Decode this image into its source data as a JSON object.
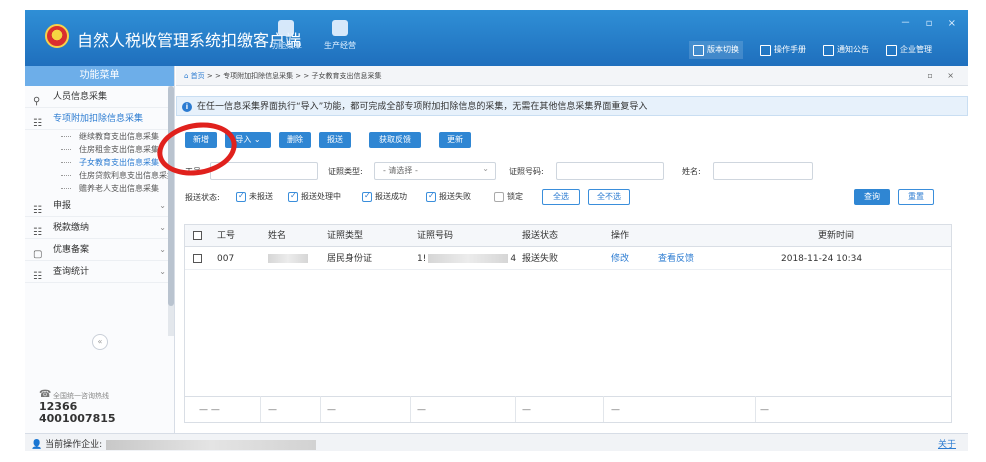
{
  "window": {
    "title": "自然人税收管理系统扣缴客户端",
    "tools": [
      "功能菜单",
      "生产经营"
    ],
    "header_buttons": [
      "版本切换",
      "操作手册",
      "通知公告",
      "企业管理"
    ],
    "controls": "－ ▫ ×"
  },
  "sidebar": {
    "header": "功能菜单",
    "items": [
      {
        "label": "人员信息采集",
        "icon": "person-icon"
      },
      {
        "label": "专项附加扣除信息采集",
        "icon": "grid-icon",
        "subitems": [
          "继续教育支出信息采集",
          "住房租金支出信息采集",
          "子女教育支出信息采集",
          "住房贷款利息支出信息采集",
          "赡养老人支出信息采集"
        ],
        "active_sub": 2
      },
      {
        "label": "申报",
        "icon": "grid-icon"
      },
      {
        "label": "税款缴纳",
        "icon": "grid-icon"
      },
      {
        "label": "优惠备案",
        "icon": "doc-icon"
      },
      {
        "label": "查询统计",
        "icon": "grid-icon"
      }
    ],
    "collapse": "«",
    "hotline_label": "全国统一咨询热线",
    "hotline_numbers": [
      "12366",
      "4001007815"
    ]
  },
  "statusbar": {
    "current_label": "当前操作企业:",
    "about": "关于"
  },
  "breadcrumb": {
    "home": "首页",
    "sep1": " > > ",
    "parent": "专项附加扣除信息采集",
    "sep2": " > > ",
    "current": "子女教育支出信息采集",
    "controls": "▫ ×"
  },
  "notice": {
    "text": "在任一信息采集界面执行“导入”功能，都可完成全部专项附加扣除信息的采集，无需在其他信息采集界面重复导入"
  },
  "toolbar": {
    "add": "新增",
    "import": "导入 ⌄",
    "delete": "删除",
    "submit": "报送",
    "feedback": "获取反馈",
    "update": "更新"
  },
  "filters": {
    "employee_no": "工号:",
    "id_type": "证照类型:",
    "id_type_value": "- 请选择 -",
    "id_no": "证照号码:",
    "name": "姓名:",
    "status_label": "报送状态:",
    "checks": [
      {
        "label": "未报送",
        "checked": true
      },
      {
        "label": "报送处理中",
        "checked": true
      },
      {
        "label": "报送成功",
        "checked": true
      },
      {
        "label": "报送失败",
        "checked": true
      },
      {
        "label": "锁定",
        "checked": false
      }
    ],
    "select_all": "全选",
    "select_none": "全不选",
    "query": "查询",
    "reset": "重置"
  },
  "table": {
    "columns": [
      "工号",
      "姓名",
      "证照类型",
      "证照号码",
      "报送状态",
      "操作",
      "更新时间"
    ],
    "rows": [
      {
        "no": "007",
        "id_type": "居民身份证",
        "id_prefix": "1!",
        "id_suffix": "4",
        "status": "报送失败",
        "edit": "修改",
        "view": "查看反馈",
        "time": "2018-11-24 10:34"
      }
    ],
    "footer_dash": "— —",
    "dash": "—"
  }
}
